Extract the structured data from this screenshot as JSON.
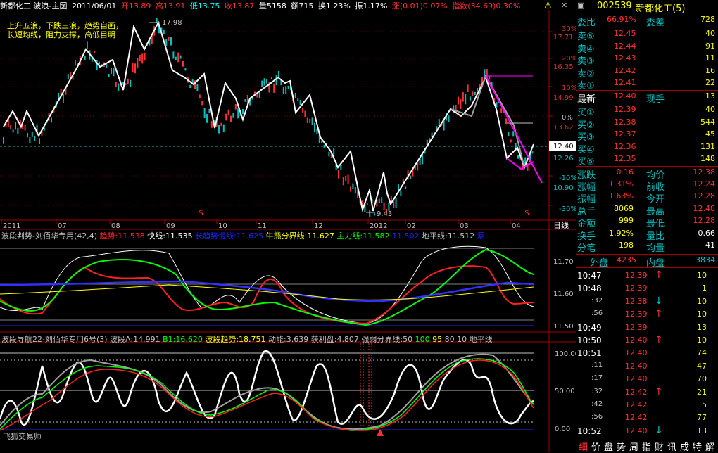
{
  "header": {
    "title": "新都化工  波浪-主图",
    "date": "2011/06/01",
    "open": "开13.89",
    "high": "高13.91",
    "low": "低13.75",
    "close": "收13.87",
    "volume": "量5158",
    "amount": "额715",
    "turnover": "换1.23%",
    "amplitude": "振1.17%",
    "change": "涨(0.01)0.07%",
    "index": "指数(34.69)0.30%"
  },
  "main_chart": {
    "note_line1": "上升五浪，下跌三浪，趋势自画，",
    "note_line2": "长短均线，阻力支撑，高低目明",
    "high_label": "17.98",
    "low_label": "9.43",
    "current_price": "12.40",
    "price_ticks": [
      "17.71",
      "16.35",
      "14.99",
      "13.62",
      "12.26",
      "10.90"
    ],
    "pct_ticks": [
      "30%",
      "20%",
      "10%",
      "0%",
      "-10%",
      "-20%",
      "-30%"
    ],
    "months": [
      "2011",
      "07",
      "08",
      "09",
      "10",
      "11",
      "12",
      "2012",
      "02",
      "03",
      "04"
    ],
    "period_label": "日线",
    "markers": [
      "$",
      "$"
    ]
  },
  "panel1": {
    "title": "波段判势-刘佰华专用(42,4)",
    "legend": [
      {
        "text": "趋势:11.538",
        "color": "#ff2020"
      },
      {
        "text": "快线:11.535",
        "color": "#ffffff"
      },
      {
        "text": "长趋势慢线:11.625",
        "color": "#2020ff"
      },
      {
        "text": "牛熊分界线:11.627",
        "color": "#ffff00"
      },
      {
        "text": "主力线:11.582",
        "color": "#00ff00"
      },
      {
        "text": "11.502",
        "color": "#2020ff"
      },
      {
        "text": "地平线:11.512",
        "color": "#c0c0c0"
      },
      {
        "text": "漏",
        "color": "#2020ff"
      }
    ],
    "ticks": [
      "11.70",
      "11.60",
      "11.50"
    ]
  },
  "panel2": {
    "title": "波段导航22-刘佰华专用6号(3)",
    "legend": [
      {
        "text": "波段A:14.991",
        "color": "#c0c0c0"
      },
      {
        "text": "B1:16.620",
        "color": "#00ff00"
      },
      {
        "text": "波段趋势:18.751",
        "color": "#ffff00"
      },
      {
        "text": "动能:3.639",
        "color": "#c0c0c0"
      },
      {
        "text": "获利盘:4.807",
        "color": "#c0c0c0"
      },
      {
        "text": "强弱分界线:50",
        "color": "#c0c0c0"
      },
      {
        "text": "100",
        "color": "#00ff00"
      },
      {
        "text": "95",
        "color": "#ffff00"
      },
      {
        "text": "80",
        "color": "#c0c0c0"
      },
      {
        "text": "10",
        "color": "#c0c0c0"
      },
      {
        "text": "地平线",
        "color": "#c0c0c0"
      }
    ],
    "ticks": [
      "100.00",
      "50.00",
      "0.00"
    ],
    "watermark": "飞狐交易师"
  },
  "quote": {
    "code": "002539",
    "name": "新都化工(5)",
    "ratio_label": "委比",
    "ratio": "66.91%",
    "diff_label": "委差",
    "diff": "728",
    "asks": [
      {
        "label": "卖⑤",
        "price": "12.45",
        "vol": "40"
      },
      {
        "label": "卖④",
        "price": "12.44",
        "vol": "91"
      },
      {
        "label": "卖③",
        "price": "12.43",
        "vol": "11"
      },
      {
        "label": "卖②",
        "price": "12.42",
        "vol": "16"
      },
      {
        "label": "卖①",
        "price": "12.41",
        "vol": "22"
      }
    ],
    "last_label": "最新",
    "last": "12.40",
    "now_hand_label": "现手",
    "now_hand": "13",
    "bids": [
      {
        "label": "买①",
        "price": "12.39",
        "vol": "40"
      },
      {
        "label": "买②",
        "price": "12.38",
        "vol": "544"
      },
      {
        "label": "买③",
        "price": "12.37",
        "vol": "45"
      },
      {
        "label": "买④",
        "price": "12.36",
        "vol": "131"
      },
      {
        "label": "买⑤",
        "price": "12.35",
        "vol": "148"
      }
    ],
    "stats": [
      {
        "l1": "涨跌",
        "v1": "0.16",
        "l2": "均价",
        "v2": "12.38"
      },
      {
        "l1": "涨幅",
        "v1": "1.31%",
        "l2": "前收",
        "v2": "12.24"
      },
      {
        "l1": "振幅",
        "v1": "1.63%",
        "l2": "今开",
        "v2": "12.28"
      },
      {
        "l1": "总手",
        "v1": "8069",
        "l2": "最高",
        "v2": "12.48"
      },
      {
        "l1": "金额",
        "v1": "999",
        "l2": "最低",
        "v2": "12.28"
      },
      {
        "l1": "换手",
        "v1": "1.92%",
        "l2": "量比",
        "v2": "0.66"
      },
      {
        "l1": "分笔",
        "v1": "198",
        "l2": "均量",
        "v2": "41"
      }
    ],
    "outer_label": "外盘",
    "outer": "4235",
    "inner_label": "内盘",
    "inner": "3834"
  },
  "ticks": [
    {
      "t": "10:47",
      "p": "12.39",
      "d": "up",
      "v": "10",
      "big": true
    },
    {
      "t": "10:48",
      "p": "12.39",
      "d": "",
      "v": "1",
      "big": true
    },
    {
      "t": ":32",
      "p": "12.38",
      "d": "down",
      "v": "10",
      "big": false
    },
    {
      "t": ":56",
      "p": "12.39",
      "d": "up",
      "v": "10",
      "big": false
    },
    {
      "t": "10:49",
      "p": "12.39",
      "d": "",
      "v": "13",
      "big": true
    },
    {
      "t": "10:50",
      "p": "12.40",
      "d": "up",
      "v": "10",
      "big": true
    },
    {
      "t": "10:51",
      "p": "12.40",
      "d": "",
      "v": "74",
      "big": true
    },
    {
      "t": ":11",
      "p": "12.40",
      "d": "",
      "v": "47",
      "big": false
    },
    {
      "t": ":17",
      "p": "12.40",
      "d": "",
      "v": "70",
      "big": false
    },
    {
      "t": ":32",
      "p": "12.42",
      "d": "up",
      "v": "21",
      "big": false
    },
    {
      "t": ":42",
      "p": "12.42",
      "d": "",
      "v": "5",
      "big": false
    },
    {
      "t": ":56",
      "p": "12.42",
      "d": "",
      "v": "77",
      "big": false
    },
    {
      "t": "10:52",
      "p": "12.40",
      "d": "down",
      "v": "13",
      "big": true
    }
  ],
  "bottom_tabs": [
    "细",
    "价",
    "盘",
    "势",
    "周",
    "指",
    "财",
    "讯",
    "成",
    "特",
    "解"
  ]
}
